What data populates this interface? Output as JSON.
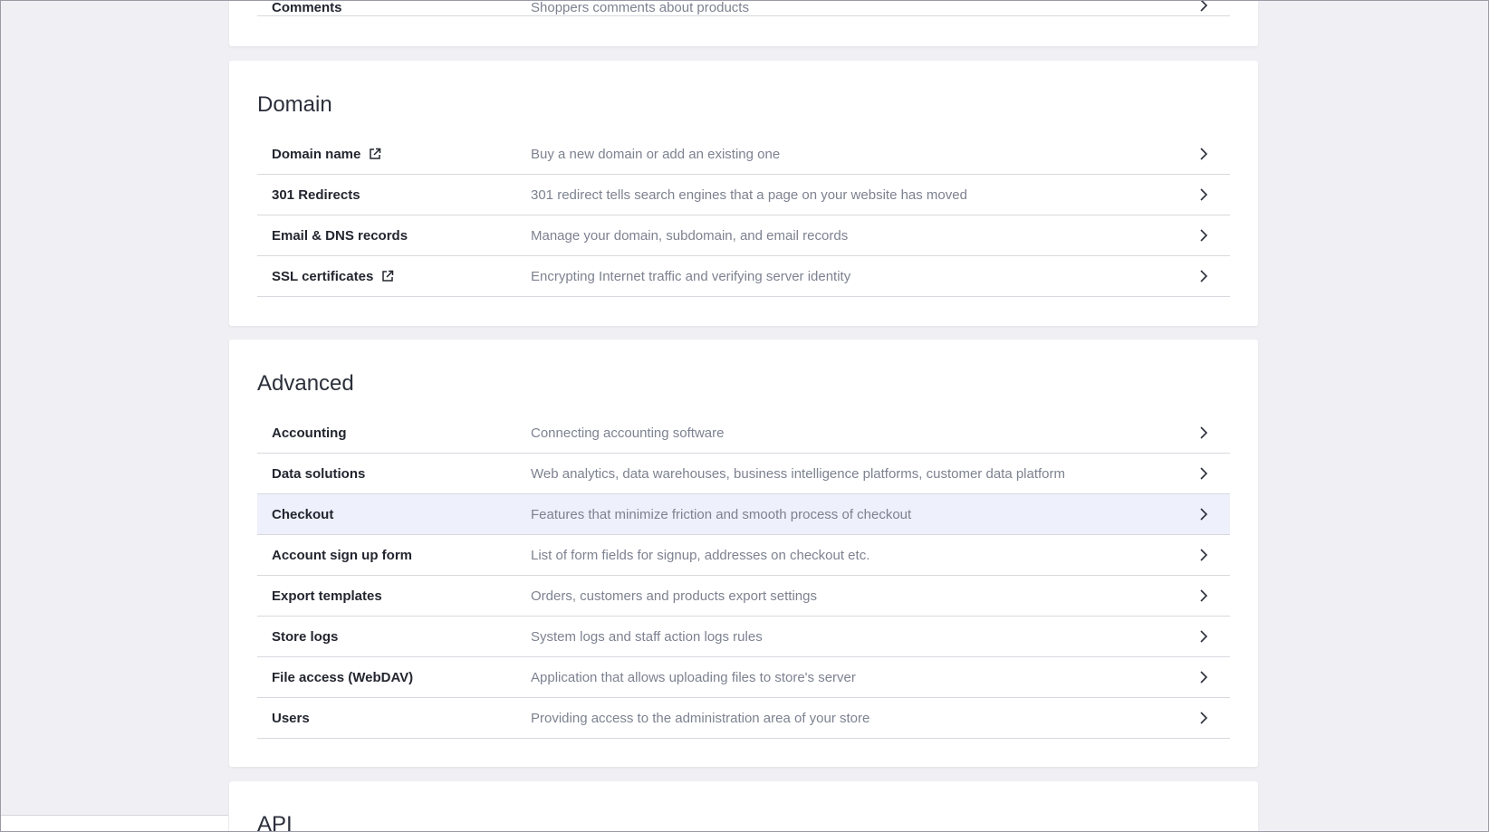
{
  "top_section": {
    "row": {
      "name": "Comments",
      "description": "Shoppers comments about products"
    }
  },
  "domain": {
    "title": "Domain",
    "rows": [
      {
        "name": "Domain name",
        "description": "Buy a new domain or add an existing one",
        "external": true
      },
      {
        "name": "301 Redirects",
        "description": "301 redirect tells search engines that a page on your website has moved",
        "external": false
      },
      {
        "name": "Email & DNS records",
        "description": "Manage your domain, subdomain, and email records",
        "external": false
      },
      {
        "name": "SSL certificates",
        "description": "Encrypting Internet traffic and verifying server identity",
        "external": true
      }
    ]
  },
  "advanced": {
    "title": "Advanced",
    "rows": [
      {
        "name": "Accounting",
        "description": "Connecting accounting software"
      },
      {
        "name": "Data solutions",
        "description": "Web analytics, data warehouses, business intelligence platforms, customer data platform"
      },
      {
        "name": "Checkout",
        "description": "Features that minimize friction and smooth process of checkout",
        "highlighted": true
      },
      {
        "name": "Account sign up form",
        "description": "List of form fields for signup, addresses on checkout etc."
      },
      {
        "name": "Export templates",
        "description": "Orders, customers and products export settings"
      },
      {
        "name": "Store logs",
        "description": "System logs and staff action logs rules"
      },
      {
        "name": "File access (WebDAV)",
        "description": "Application that allows uploading files to store's server"
      },
      {
        "name": "Users",
        "description": "Providing access to the administration area of your store"
      }
    ]
  },
  "api": {
    "title": "API"
  },
  "icons": {
    "external": "external-link-icon",
    "chevron": "chevron-right-icon"
  },
  "colors": {
    "highlight_row": "#eef0fb",
    "page_background": "#f0f0f4"
  }
}
